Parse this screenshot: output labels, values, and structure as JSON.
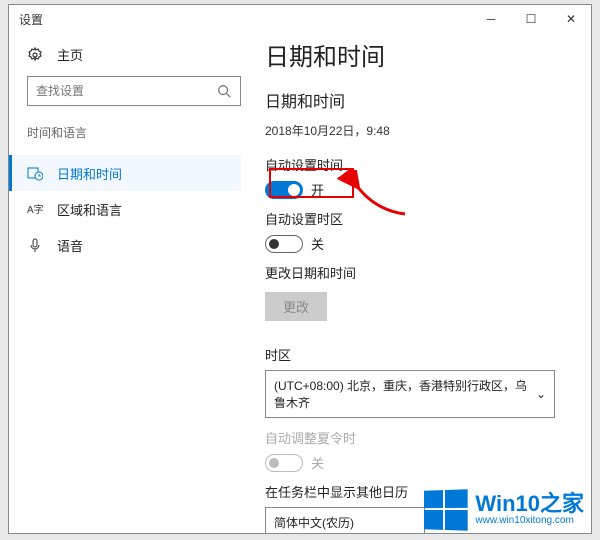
{
  "titlebar": {
    "title": "设置"
  },
  "sidebar": {
    "home": "主页",
    "search_placeholder": "查找设置",
    "section": "时间和语言",
    "items": [
      {
        "label": "日期和时间"
      },
      {
        "label": "区域和语言"
      },
      {
        "label": "语音"
      }
    ]
  },
  "main": {
    "heading": "日期和时间",
    "subheading": "日期和时间",
    "timestamp": "2018年10月22日，9:48",
    "auto_time_label": "自动设置时间",
    "auto_time_state": "开",
    "auto_tz_label": "自动设置时区",
    "auto_tz_state": "关",
    "change_label": "更改日期和时间",
    "change_button": "更改",
    "tz_label": "时区",
    "tz_value": "(UTC+08:00) 北京，重庆，香港特别行政区，乌鲁木齐",
    "dst_label": "自动调整夏令时",
    "dst_state": "关",
    "taskbar_label": "在任务栏中显示其他日历",
    "taskbar_value": "简体中文(农历)"
  },
  "branding": {
    "name": "Win10之家",
    "url": "www.win10xitong.com"
  }
}
